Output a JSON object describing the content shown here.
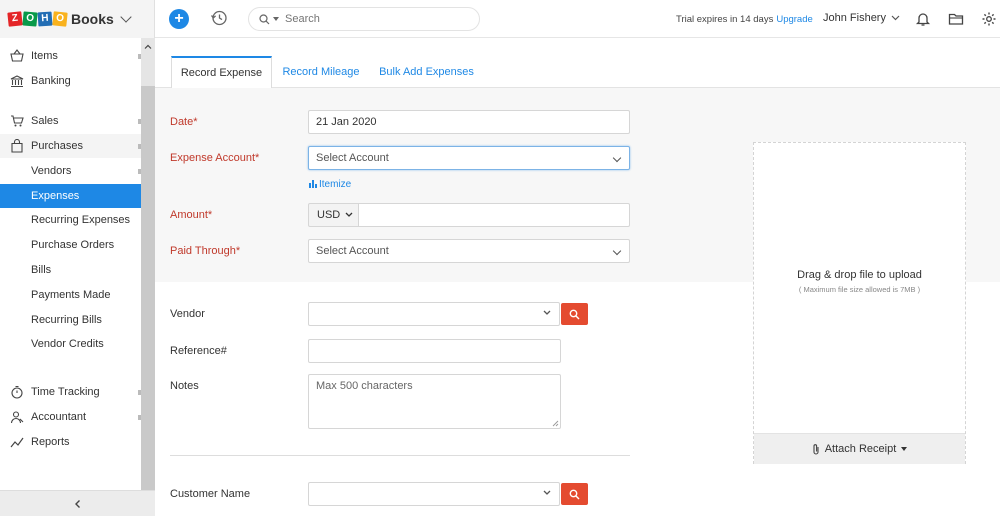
{
  "app": {
    "brand_letters": [
      "Z",
      "O",
      "H",
      "O"
    ],
    "brand_colors": [
      "#e42527",
      "#089949",
      "#226db4",
      "#f9b21d"
    ],
    "name": "Books"
  },
  "topbar": {
    "search_placeholder": "Search",
    "trial_text": "Trial expires in 14 days",
    "upgrade_label": "Upgrade",
    "user_name": "John Fishery"
  },
  "sidebar": {
    "items": [
      {
        "label": "Items",
        "icon": "basket-icon"
      },
      {
        "label": "Banking",
        "icon": "bank-icon"
      },
      {
        "label": "Sales",
        "icon": "cart-icon"
      },
      {
        "label": "Purchases",
        "icon": "bag-icon"
      },
      {
        "label": "Vendors"
      },
      {
        "label": "Expenses"
      },
      {
        "label": "Recurring Expenses"
      },
      {
        "label": "Purchase Orders"
      },
      {
        "label": "Bills"
      },
      {
        "label": "Payments Made"
      },
      {
        "label": "Recurring Bills"
      },
      {
        "label": "Vendor Credits"
      },
      {
        "label": "Time Tracking",
        "icon": "stopwatch-icon"
      },
      {
        "label": "Accountant",
        "icon": "accountant-icon"
      },
      {
        "label": "Reports",
        "icon": "reports-icon"
      }
    ]
  },
  "tabs": [
    {
      "label": "Record Expense"
    },
    {
      "label": "Record Mileage"
    },
    {
      "label": "Bulk Add Expenses"
    }
  ],
  "form": {
    "date_label": "Date*",
    "date_value": "21 Jan 2020",
    "expense_account_label": "Expense Account*",
    "expense_account_value": "Select Account",
    "itemize_label": "Itemize",
    "amount_label": "Amount*",
    "currency": "USD",
    "amount_value": "",
    "paid_through_label": "Paid Through*",
    "paid_through_value": "Select Account",
    "vendor_label": "Vendor",
    "vendor_value": "",
    "reference_label": "Reference#",
    "reference_value": "",
    "notes_label": "Notes",
    "notes_placeholder": "Max 500 characters",
    "customer_label": "Customer Name",
    "customer_value": ""
  },
  "upload": {
    "title": "Drag & drop file to upload",
    "subtitle": "( Maximum file size allowed is 7MB )",
    "attach_label": "Attach Receipt"
  },
  "colors": {
    "accent": "#1e88e5",
    "required": "#c0392b",
    "search_button": "#e44b30"
  }
}
